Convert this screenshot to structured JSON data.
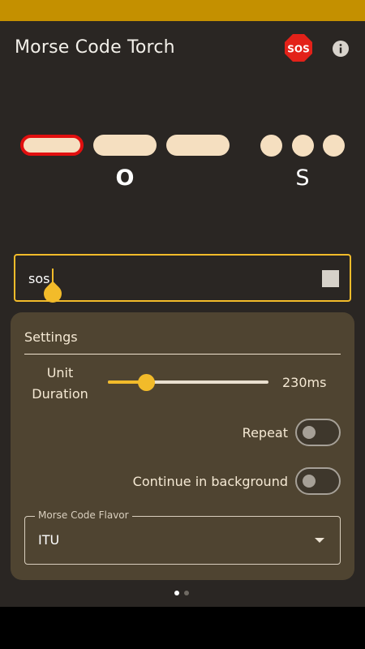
{
  "app": {
    "title": "Morse Code Torch",
    "sos_label": "SOS",
    "sos_icon": "sos-stop-sign-icon",
    "info_icon": "info-icon"
  },
  "morse": {
    "letters": [
      "O",
      "S"
    ],
    "active_color": "#e10f0f",
    "symbol_color": "#f5dfc0"
  },
  "input": {
    "value": "sos",
    "stop_icon": "stop-icon"
  },
  "settings": {
    "title": "Settings",
    "unit_duration_label": "Unit Duration",
    "unit_duration_value": "230ms",
    "unit_duration_fraction": 0.24,
    "repeat_label": "Repeat",
    "repeat_on": false,
    "background_label": "Continue in background",
    "background_on": false,
    "flavor_label": "Morse Code Flavor",
    "flavor_value": "ITU"
  },
  "pager": {
    "current": 1,
    "total": 2
  },
  "colors": {
    "accent": "#f2bb2a",
    "status_bar": "#c49000",
    "panel": "#4f4431",
    "background": "#2a2623"
  }
}
